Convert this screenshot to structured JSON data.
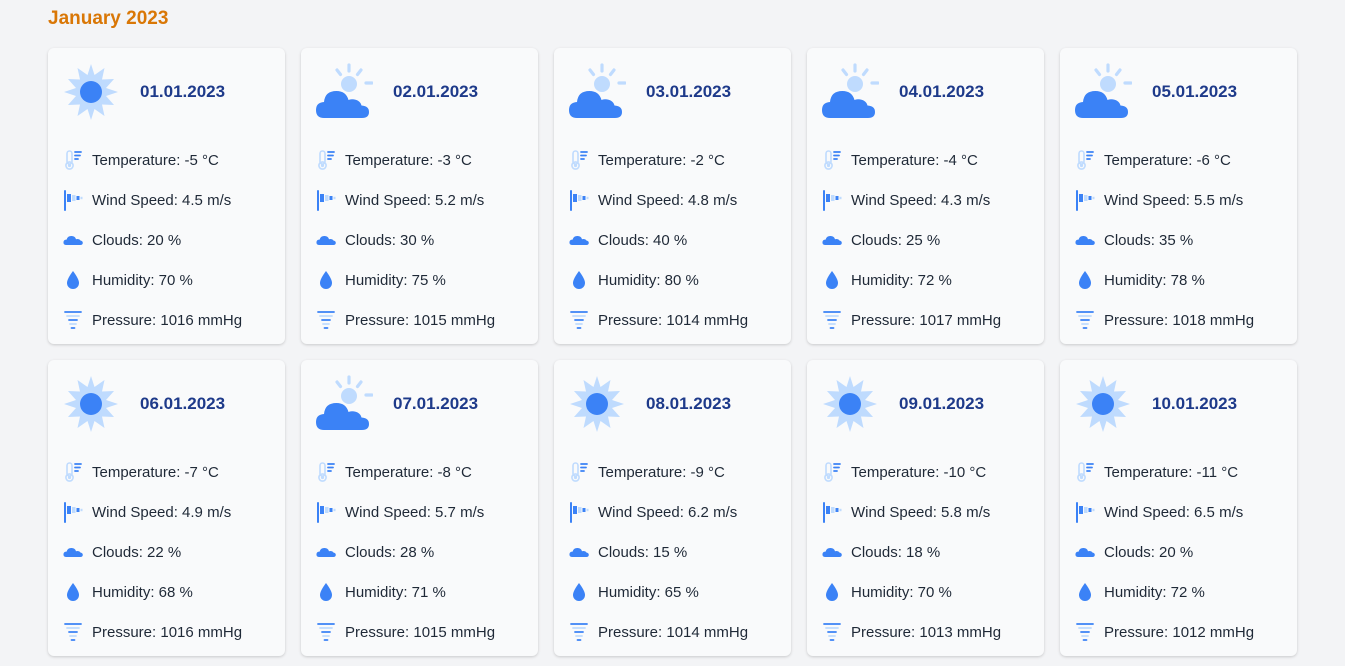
{
  "month": "January 2023",
  "colors": {
    "accent": "#d97706",
    "date": "#1e3a8a",
    "icon_primary": "#3b82f6",
    "icon_light": "#bfdbfe"
  },
  "days": [
    {
      "date": "01.01.2023",
      "icon": "sun-icon",
      "temperature": "Temperature: -5 °C",
      "wind": "Wind Speed: 4.5 m/s",
      "clouds": "Clouds: 20 %",
      "humidity": "Humidity: 70 %",
      "pressure": "Pressure: 1016 mmHg"
    },
    {
      "date": "02.01.2023",
      "icon": "partly-cloudy-icon",
      "temperature": "Temperature: -3 °C",
      "wind": "Wind Speed: 5.2 m/s",
      "clouds": "Clouds: 30 %",
      "humidity": "Humidity: 75 %",
      "pressure": "Pressure: 1015 mmHg"
    },
    {
      "date": "03.01.2023",
      "icon": "partly-cloudy-icon",
      "temperature": "Temperature: -2 °C",
      "wind": "Wind Speed: 4.8 m/s",
      "clouds": "Clouds: 40 %",
      "humidity": "Humidity: 80 %",
      "pressure": "Pressure: 1014 mmHg"
    },
    {
      "date": "04.01.2023",
      "icon": "partly-cloudy-icon",
      "temperature": "Temperature: -4 °C",
      "wind": "Wind Speed: 4.3 m/s",
      "clouds": "Clouds: 25 %",
      "humidity": "Humidity: 72 %",
      "pressure": "Pressure: 1017 mmHg"
    },
    {
      "date": "05.01.2023",
      "icon": "partly-cloudy-icon",
      "temperature": "Temperature: -6 °C",
      "wind": "Wind Speed: 5.5 m/s",
      "clouds": "Clouds: 35 %",
      "humidity": "Humidity: 78 %",
      "pressure": "Pressure: 1018 mmHg"
    },
    {
      "date": "06.01.2023",
      "icon": "sun-icon",
      "temperature": "Temperature: -7 °C",
      "wind": "Wind Speed: 4.9 m/s",
      "clouds": "Clouds: 22 %",
      "humidity": "Humidity: 68 %",
      "pressure": "Pressure: 1016 mmHg"
    },
    {
      "date": "07.01.2023",
      "icon": "partly-cloudy-icon",
      "temperature": "Temperature: -8 °C",
      "wind": "Wind Speed: 5.7 m/s",
      "clouds": "Clouds: 28 %",
      "humidity": "Humidity: 71 %",
      "pressure": "Pressure: 1015 mmHg"
    },
    {
      "date": "08.01.2023",
      "icon": "sun-icon",
      "temperature": "Temperature: -9 °C",
      "wind": "Wind Speed: 6.2 m/s",
      "clouds": "Clouds: 15 %",
      "humidity": "Humidity: 65 %",
      "pressure": "Pressure: 1014 mmHg"
    },
    {
      "date": "09.01.2023",
      "icon": "sun-icon",
      "temperature": "Temperature: -10 °C",
      "wind": "Wind Speed: 5.8 m/s",
      "clouds": "Clouds: 18 %",
      "humidity": "Humidity: 70 %",
      "pressure": "Pressure: 1013 mmHg"
    },
    {
      "date": "10.01.2023",
      "icon": "sun-icon",
      "temperature": "Temperature: -11 °C",
      "wind": "Wind Speed: 6.5 m/s",
      "clouds": "Clouds: 20 %",
      "humidity": "Humidity: 72 %",
      "pressure": "Pressure: 1012 mmHg"
    }
  ]
}
